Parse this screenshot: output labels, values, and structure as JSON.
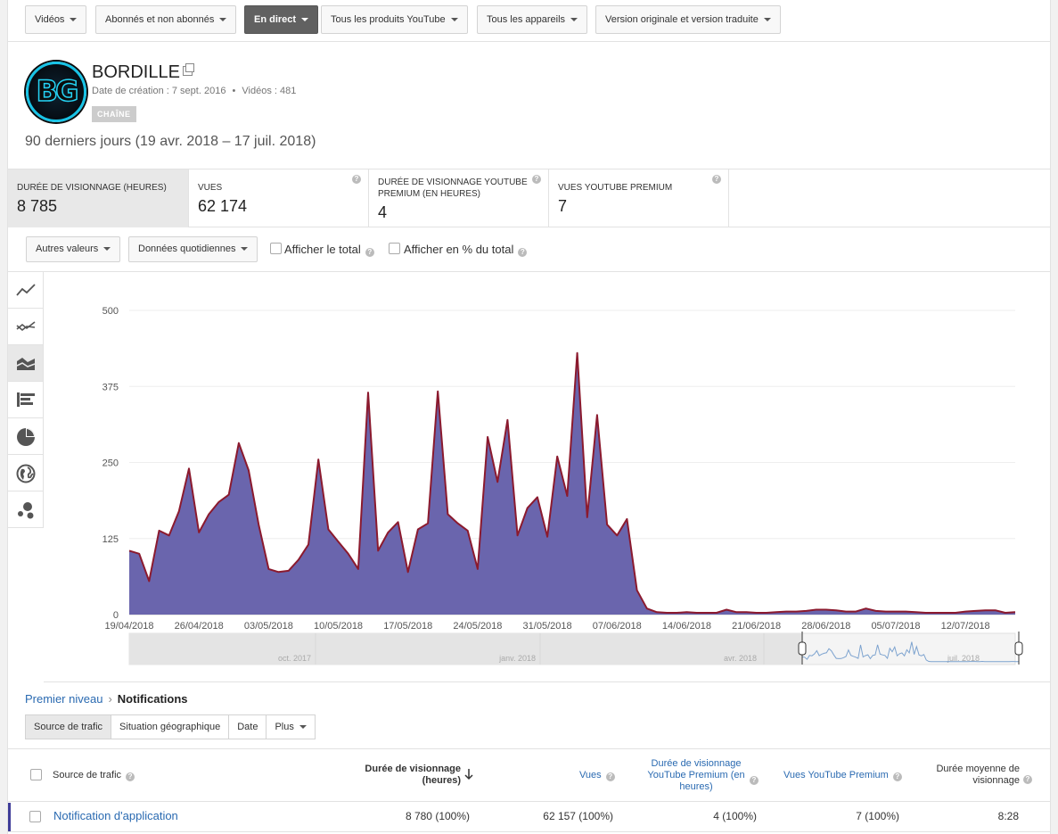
{
  "filters": [
    {
      "label": "Vidéos",
      "active": false
    },
    {
      "label": "Abonnés et non abonnés",
      "active": false
    },
    {
      "label": "En direct",
      "active": true
    },
    {
      "label": "Tous les produits YouTube",
      "active": false
    },
    {
      "label": "Tous les appareils",
      "active": false
    },
    {
      "label": "Version originale et version traduite",
      "active": false
    }
  ],
  "channel": {
    "name": "BORDILLE",
    "avatar_text": "BG",
    "created": "Date de création : 7 sept. 2016",
    "videos": "Vidéos : 481",
    "badge": "CHAÎNE",
    "date_range": "90 derniers jours (19 avr. 2018 – 17 juil. 2018)"
  },
  "metrics": [
    {
      "label": "DURÉE DE VISIONNAGE (HEURES)",
      "value": "8 785"
    },
    {
      "label": "VUES",
      "value": "62 174"
    },
    {
      "label": "DURÉE DE VISIONNAGE YOUTUBE PREMIUM (EN HEURES)",
      "value": "4"
    },
    {
      "label": "VUES YOUTUBE PREMIUM",
      "value": "7"
    }
  ],
  "options": {
    "more_values": "Autres valeurs",
    "granularity": "Données quotidiennes",
    "show_total": "Afficher le total",
    "show_percent": "Afficher en % du total"
  },
  "chart_types": [
    "line-chart-icon",
    "multi-line-chart-icon",
    "stacked-area-chart-icon",
    "bar-chart-icon",
    "pie-chart-icon",
    "globe-map-icon",
    "bubble-chart-icon"
  ],
  "chart_data": {
    "type": "area",
    "ylim": [
      0,
      500
    ],
    "yticks": [
      "500",
      "375",
      "250",
      "125",
      "0"
    ],
    "xticks": [
      "19/04/2018",
      "26/04/2018",
      "03/05/2018",
      "10/05/2018",
      "17/05/2018",
      "24/05/2018",
      "31/05/2018",
      "07/06/2018",
      "14/06/2018",
      "21/06/2018",
      "28/06/2018",
      "05/07/2018",
      "12/07/2018"
    ],
    "x_start": "2018-04-19",
    "values": [
      105,
      100,
      55,
      138,
      130,
      170,
      240,
      135,
      165,
      185,
      197,
      282,
      237,
      148,
      75,
      70,
      72,
      90,
      115,
      255,
      140,
      120,
      100,
      75,
      365,
      105,
      135,
      152,
      70,
      140,
      150,
      367,
      165,
      150,
      138,
      75,
      292,
      218,
      320,
      130,
      175,
      193,
      128,
      260,
      195,
      430,
      160,
      328,
      148,
      130,
      157,
      40,
      10,
      4,
      3,
      3,
      4,
      3,
      3,
      3,
      8,
      4,
      4,
      3,
      3,
      4,
      5,
      5,
      6,
      8,
      8,
      7,
      5,
      5,
      10,
      6,
      5,
      5,
      5,
      4,
      3,
      3,
      3,
      3,
      5,
      6,
      7,
      7,
      3,
      4
    ],
    "colors": {
      "fill": "#6a65ad",
      "line": "#8b1a2e"
    },
    "overview_labels": [
      "oct. 2017",
      "janv. 2018",
      "avr. 2018",
      "juil. 2018"
    ]
  },
  "breadcrumb": {
    "root": "Premier niveau",
    "separator": "›",
    "current": "Notifications"
  },
  "tabs": [
    {
      "label": "Source de trafic",
      "active": true
    },
    {
      "label": "Situation géographique",
      "active": false
    },
    {
      "label": "Date",
      "active": false
    },
    {
      "label": "Plus",
      "active": false
    }
  ],
  "table": {
    "headers": {
      "source": "Source de trafic",
      "watch_time_1": "Durée de visionnage",
      "watch_time_2": "(heures)",
      "views": "Vues",
      "premium_watch_1": "Durée de visionnage",
      "premium_watch_2": "YouTube Premium (en",
      "premium_watch_3": "heures)",
      "premium_views": "Vues YouTube Premium",
      "avg_1": "Durée moyenne de",
      "avg_2": "visionnage"
    },
    "rows": [
      {
        "source": "Notification d'application",
        "watch_time": "8 780 (100%)",
        "views": "62 157 (100%)",
        "premium_watch": "4 (100%)",
        "premium_views": "7 (100%)",
        "avg": "8:28"
      }
    ]
  }
}
